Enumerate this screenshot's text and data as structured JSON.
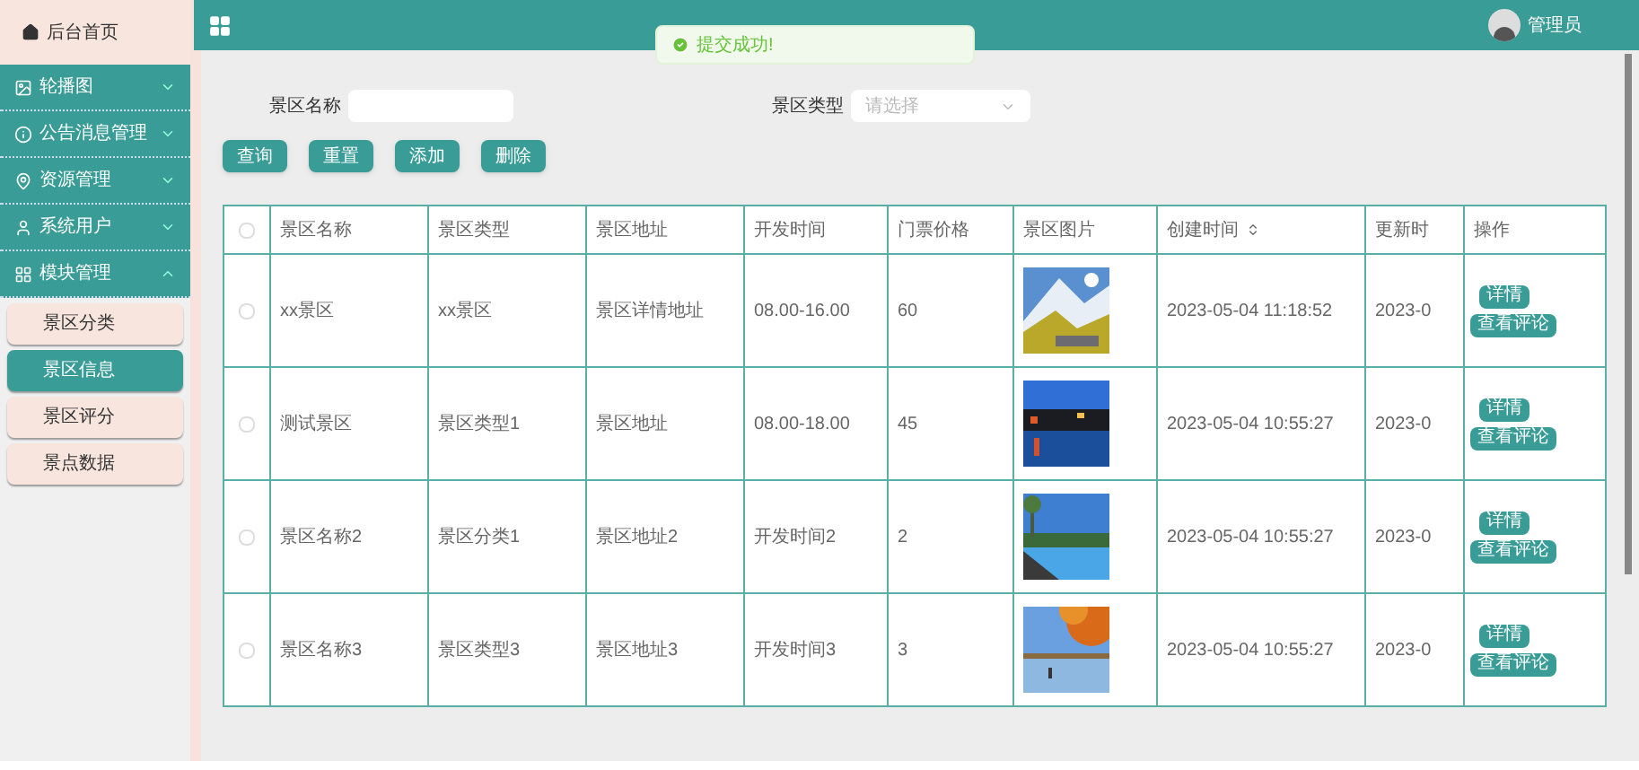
{
  "sidebar": {
    "home": {
      "label": "后台首页"
    },
    "menus": [
      {
        "label": "轮播图",
        "expanded": false
      },
      {
        "label": "公告消息管理",
        "expanded": false
      },
      {
        "label": "资源管理",
        "expanded": false
      },
      {
        "label": "系统用户",
        "expanded": false
      },
      {
        "label": "模块管理",
        "expanded": true,
        "children": [
          {
            "label": "景区分类",
            "selected": false
          },
          {
            "label": "景区信息",
            "selected": true
          },
          {
            "label": "景区评分",
            "selected": false
          },
          {
            "label": "景点数据",
            "selected": false
          }
        ]
      }
    ]
  },
  "header": {
    "user": "管理员"
  },
  "toast": {
    "message": "提交成功!"
  },
  "search": {
    "fields": [
      {
        "kind": "input",
        "label": "景区名称"
      },
      {
        "kind": "select",
        "label": "景区类型",
        "placeholder": "请选择"
      }
    ],
    "buttons": [
      "查询",
      "重置",
      "添加",
      "删除"
    ]
  },
  "table": {
    "all_checked": false,
    "columns": [
      {
        "label": "景区名称",
        "sortable": false
      },
      {
        "label": "景区类型",
        "sortable": false
      },
      {
        "label": "景区地址",
        "sortable": false
      },
      {
        "label": "开发时间",
        "sortable": false
      },
      {
        "label": "门票价格",
        "sortable": false
      },
      {
        "label": "景区图片",
        "sortable": false
      },
      {
        "label": "创建时间",
        "sortable": true
      },
      {
        "label": "更新时",
        "sortable": false
      },
      {
        "label": "操作",
        "sortable": false
      }
    ],
    "rows": [
      {
        "checked": false,
        "cells": [
          "xx景区",
          "xx景区",
          "景区详情地址",
          "08.00-16.00",
          "60"
        ],
        "created": "2023-05-04 11:18:52",
        "updated": "2023-0",
        "actions": [
          "详情",
          "查看评论"
        ]
      },
      {
        "checked": false,
        "cells": [
          "测试景区",
          "景区类型1",
          "景区地址",
          "08.00-18.00",
          "45"
        ],
        "created": "2023-05-04 10:55:27",
        "updated": "2023-0",
        "actions": [
          "详情",
          "查看评论"
        ]
      },
      {
        "checked": false,
        "cells": [
          "景区名称2",
          "景区分类1",
          "景区地址2",
          "开发时间2",
          "2"
        ],
        "created": "2023-05-04 10:55:27",
        "updated": "2023-0",
        "actions": [
          "详情",
          "查看评论"
        ]
      },
      {
        "checked": false,
        "cells": [
          "景区名称3",
          "景区类型3",
          "景区地址3",
          "开发时间3",
          "3"
        ],
        "created": "2023-05-04 10:55:27",
        "updated": "2023-0",
        "actions": [
          "详情",
          "查看评论"
        ]
      }
    ]
  }
}
